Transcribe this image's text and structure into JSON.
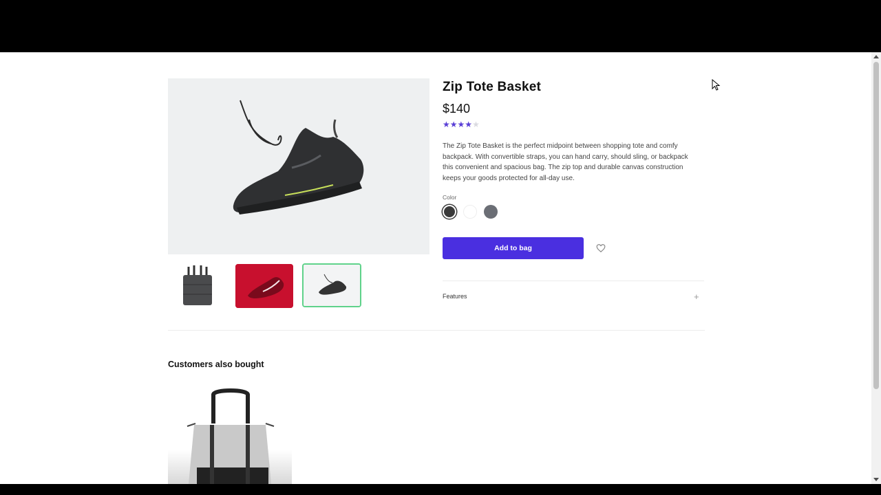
{
  "product": {
    "title": "Zip Tote Basket",
    "price": "$140",
    "rating": 4,
    "rating_max": 5,
    "description": "The Zip Tote Basket is the perfect midpoint between shopping tote and comfy backpack. With convertible straps, you can hand carry, should sling, or backpack this convenient and spacious bag. The zip top and durable canvas construction keeps your goods protected for all-day use.",
    "color_label": "Color",
    "colors": [
      "#3a3a3a",
      "#ffffff",
      "#6b6e75"
    ],
    "add_to_bag_label": "Add to bag"
  },
  "sections": {
    "features_label": "Features",
    "also_bought_title": "Customers also bought"
  },
  "colors": {
    "accent": "#4a2fe0",
    "star": "#5a3fd6",
    "thumb_selected_border": "#5fd28a"
  }
}
